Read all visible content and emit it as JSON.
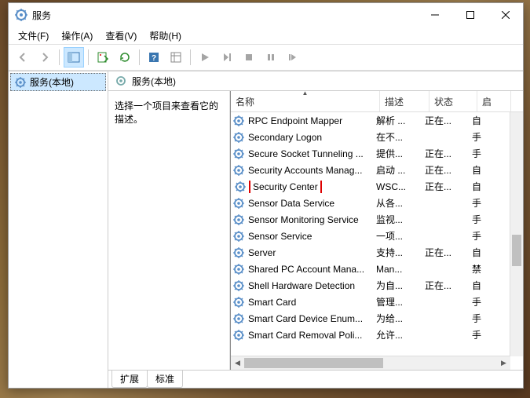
{
  "window": {
    "title": "服务"
  },
  "menu": {
    "file": "文件(F)",
    "action": "操作(A)",
    "view": "查看(V)",
    "help": "帮助(H)"
  },
  "tree": {
    "root": "服务(本地)"
  },
  "header": {
    "title": "服务(本地)"
  },
  "desc": {
    "prompt": "选择一个项目来查看它的描述。"
  },
  "columns": {
    "name": "名称",
    "desc": "描述",
    "status": "状态",
    "startup": "启"
  },
  "services": [
    {
      "name": "RPC Endpoint Mapper",
      "desc": "解析 ...",
      "status": "正在...",
      "startup": "自"
    },
    {
      "name": "Secondary Logon",
      "desc": "在不...",
      "status": "",
      "startup": "手"
    },
    {
      "name": "Secure Socket Tunneling ...",
      "desc": "提供...",
      "status": "正在...",
      "startup": "手"
    },
    {
      "name": "Security Accounts Manag...",
      "desc": "启动 ...",
      "status": "正在...",
      "startup": "自"
    },
    {
      "name": "Security Center",
      "desc": "WSC...",
      "status": "正在...",
      "startup": "自",
      "hl": true
    },
    {
      "name": "Sensor Data Service",
      "desc": "从各...",
      "status": "",
      "startup": "手"
    },
    {
      "name": "Sensor Monitoring Service",
      "desc": "监视...",
      "status": "",
      "startup": "手"
    },
    {
      "name": "Sensor Service",
      "desc": "一项...",
      "status": "",
      "startup": "手"
    },
    {
      "name": "Server",
      "desc": "支持...",
      "status": "正在...",
      "startup": "自"
    },
    {
      "name": "Shared PC Account Mana...",
      "desc": "Man...",
      "status": "",
      "startup": "禁"
    },
    {
      "name": "Shell Hardware Detection",
      "desc": "为自...",
      "status": "正在...",
      "startup": "自"
    },
    {
      "name": "Smart Card",
      "desc": "管理...",
      "status": "",
      "startup": "手"
    },
    {
      "name": "Smart Card Device Enum...",
      "desc": "为给...",
      "status": "",
      "startup": "手"
    },
    {
      "name": "Smart Card Removal Poli...",
      "desc": "允许...",
      "status": "",
      "startup": "手"
    }
  ],
  "tabs": {
    "ext": "扩展",
    "std": "标准"
  }
}
